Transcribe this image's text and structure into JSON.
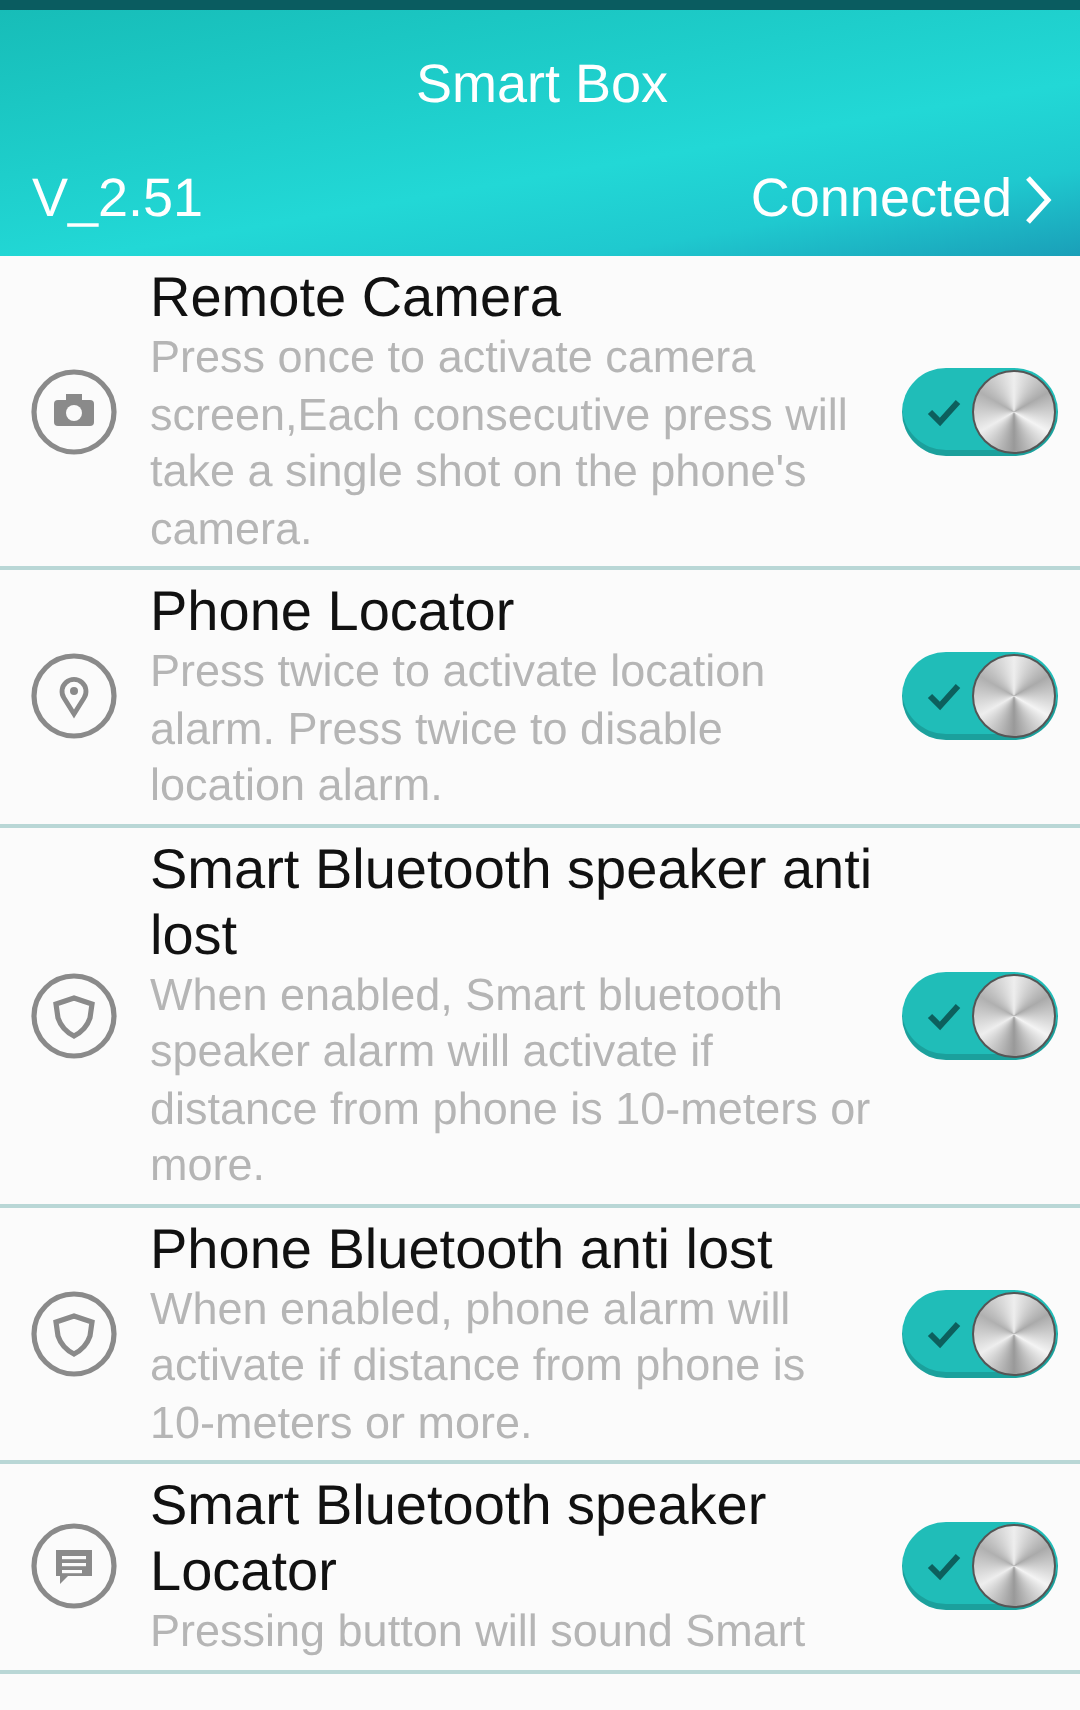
{
  "header": {
    "title": "Smart Box",
    "version": "V_2.51",
    "status": "Connected"
  },
  "settings": [
    {
      "kind": "camera",
      "title": "Remote Camera",
      "description": "Press once to activate camera screen,Each consecutive press will take a single shot on the phone's camera.",
      "on": true
    },
    {
      "kind": "pin",
      "title": "Phone Locator",
      "description": "Press twice to activate location alarm. Press twice to disable location alarm.",
      "on": true
    },
    {
      "kind": "shield",
      "title": "Smart Bluetooth speaker anti lost",
      "description": "When enabled, Smart bluetooth speaker alarm will activate if distance from phone is 10-meters or more.",
      "on": true
    },
    {
      "kind": "shield",
      "title": "Phone Bluetooth anti lost",
      "description": "When enabled, phone alarm will activate if distance from phone is 10-meters or more.",
      "on": true
    },
    {
      "kind": "message",
      "title": "Smart Bluetooth speaker Locator",
      "description": "Pressing button will sound Smart",
      "on": true
    }
  ]
}
